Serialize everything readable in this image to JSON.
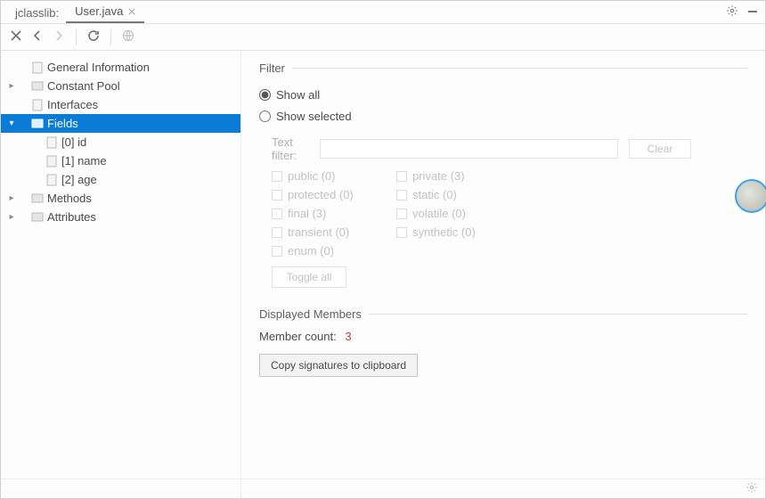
{
  "titlebar": {
    "app_label": "jclasslib:",
    "tab_label": "User.java"
  },
  "tree": {
    "general_information": "General Information",
    "constant_pool": "Constant Pool",
    "interfaces": "Interfaces",
    "fields": "Fields",
    "field_items": [
      "[0] id",
      "[1] name",
      "[2] age"
    ],
    "methods": "Methods",
    "attributes": "Attributes"
  },
  "filter": {
    "heading": "Filter",
    "show_all_label": "Show all",
    "show_selected_label": "Show selected",
    "text_filter_label": "Text filter:",
    "clear_label": "Clear",
    "modifiers": [
      {
        "name": "public",
        "count": 0
      },
      {
        "name": "private",
        "count": 3
      },
      {
        "name": "protected",
        "count": 0
      },
      {
        "name": "static",
        "count": 0
      },
      {
        "name": "final",
        "count": 3
      },
      {
        "name": "volatile",
        "count": 0
      },
      {
        "name": "transient",
        "count": 0
      },
      {
        "name": "synthetic",
        "count": 0
      },
      {
        "name": "enum",
        "count": 0
      }
    ],
    "toggle_all_label": "Toggle all"
  },
  "displayed": {
    "heading": "Displayed Members",
    "member_count_label": "Member count:",
    "member_count": "3",
    "copy_label": "Copy signatures to clipboard"
  }
}
